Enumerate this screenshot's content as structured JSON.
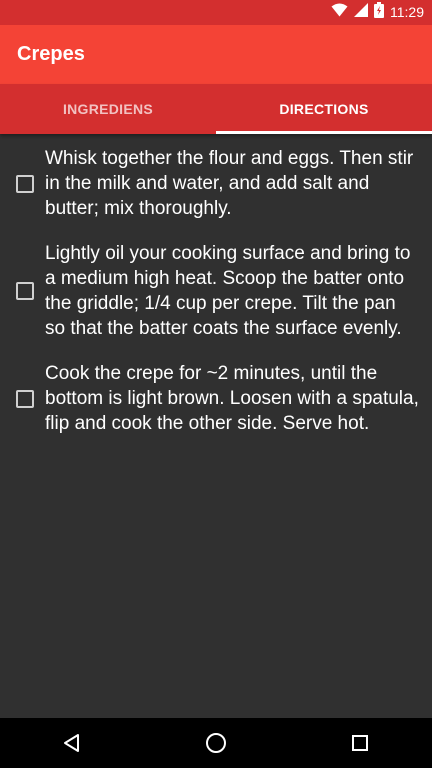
{
  "status_bar": {
    "time": "11:29"
  },
  "app_bar": {
    "title": "Crepes"
  },
  "tabs": [
    {
      "label": "INGREDIENS",
      "active": false
    },
    {
      "label": "DIRECTIONS",
      "active": true
    }
  ],
  "steps": [
    {
      "text": "Whisk together the flour and eggs. Then stir in the milk and water, and add salt and butter; mix thoroughly.",
      "checked": false
    },
    {
      "text": "Lightly oil your cooking surface and bring to a medium high heat. Scoop the batter onto the griddle; 1/4 cup per crepe. Tilt the pan so that the batter coats the surface evenly.",
      "checked": false
    },
    {
      "text": "Cook the crepe for ~2 minutes, until the bottom is light brown. Loosen with a spatula, flip and cook the other side. Serve hot.",
      "checked": false
    }
  ],
  "colors": {
    "status_bar": "#D32F2F",
    "app_bar": "#F44336",
    "tab_bar": "#D32F2F",
    "background": "#303030",
    "nav_bar": "#000000"
  },
  "icons": [
    "wifi-icon",
    "cell-signal-icon",
    "battery-icon",
    "back-icon",
    "home-icon",
    "recents-icon"
  ]
}
